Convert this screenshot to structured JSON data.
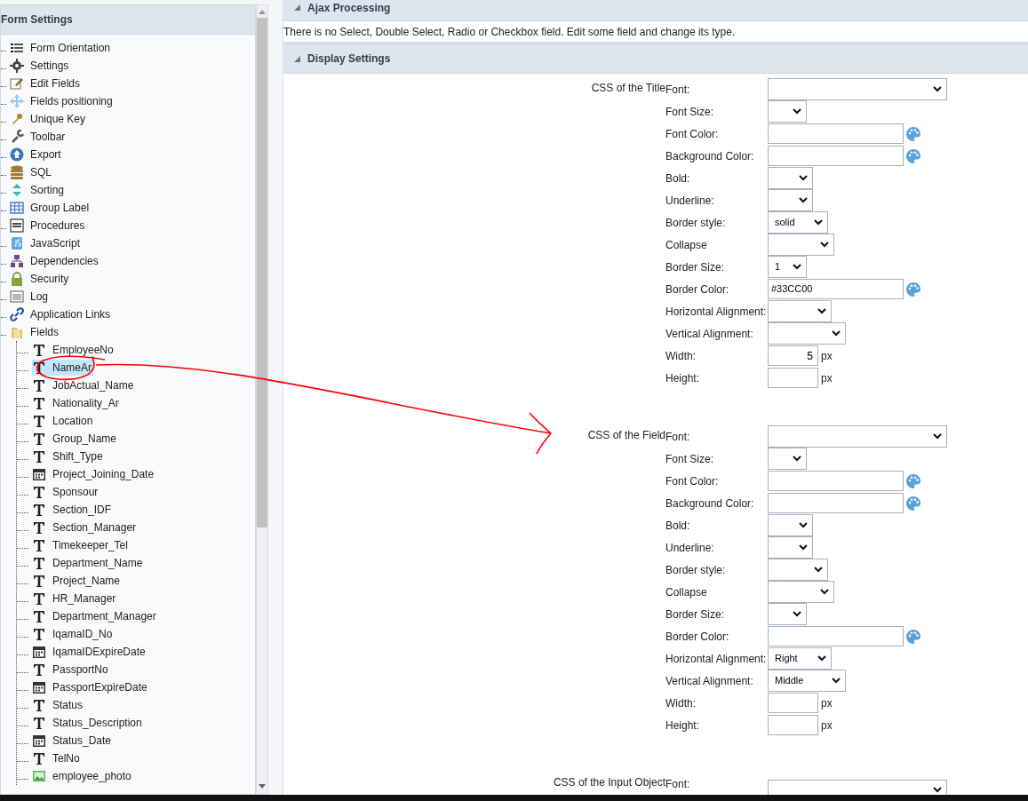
{
  "sidebar": {
    "title": "Form Settings",
    "items": [
      {
        "label": "Form Orientation"
      },
      {
        "label": "Settings"
      },
      {
        "label": "Edit Fields"
      },
      {
        "label": "Fields positioning"
      },
      {
        "label": "Unique Key"
      },
      {
        "label": "Toolbar"
      },
      {
        "label": "Export"
      },
      {
        "label": "SQL"
      },
      {
        "label": "Sorting"
      },
      {
        "label": "Group Label"
      },
      {
        "label": "Procedures"
      },
      {
        "label": "JavaScript"
      },
      {
        "label": "Dependencies"
      },
      {
        "label": "Security"
      },
      {
        "label": "Log"
      },
      {
        "label": "Application Links"
      },
      {
        "label": "Fields",
        "expanded": true,
        "children": [
          {
            "label": "EmployeeNo",
            "kind": "text",
            "selected": false
          },
          {
            "label": "NameAr",
            "kind": "text",
            "selected": true
          },
          {
            "label": "JobActual_Name",
            "kind": "text",
            "selected": false
          },
          {
            "label": "Nationality_Ar",
            "kind": "text",
            "selected": false
          },
          {
            "label": "Location",
            "kind": "text",
            "selected": false
          },
          {
            "label": "Group_Name",
            "kind": "text",
            "selected": false
          },
          {
            "label": "Shift_Type",
            "kind": "text",
            "selected": false
          },
          {
            "label": "Project_Joining_Date",
            "kind": "date",
            "selected": false
          },
          {
            "label": "Sponsour",
            "kind": "text",
            "selected": false
          },
          {
            "label": "Section_IDF",
            "kind": "text",
            "selected": false
          },
          {
            "label": "Section_Manager",
            "kind": "text",
            "selected": false
          },
          {
            "label": "Timekeeper_Tel",
            "kind": "text",
            "selected": false
          },
          {
            "label": "Department_Name",
            "kind": "text",
            "selected": false
          },
          {
            "label": "Project_Name",
            "kind": "text",
            "selected": false
          },
          {
            "label": "HR_Manager",
            "kind": "text",
            "selected": false
          },
          {
            "label": "Department_Manager",
            "kind": "text",
            "selected": false
          },
          {
            "label": "IqamaID_No",
            "kind": "text",
            "selected": false
          },
          {
            "label": "IqamaIDExpireDate",
            "kind": "date",
            "selected": false
          },
          {
            "label": "PassportNo",
            "kind": "text",
            "selected": false
          },
          {
            "label": "PassportExpireDate",
            "kind": "date",
            "selected": false
          },
          {
            "label": "Status",
            "kind": "text",
            "selected": false
          },
          {
            "label": "Status_Description",
            "kind": "text",
            "selected": false
          },
          {
            "label": "Status_Date",
            "kind": "date",
            "selected": false
          },
          {
            "label": "TelNo",
            "kind": "text",
            "selected": false
          },
          {
            "label": "employee_photo",
            "kind": "image",
            "selected": false
          }
        ]
      }
    ]
  },
  "ajax": {
    "title": "Ajax Processing",
    "message": "There is no Select, Double Select, Radio or Checkbox field. Edit some field and change its type."
  },
  "display": {
    "title": "Display Settings",
    "sections": [
      {
        "title": "CSS of the Title",
        "rows": [
          {
            "label": "Font:",
            "kind": "select"
          },
          {
            "label": "Font Size:",
            "kind": "select"
          },
          {
            "label": "Font Color:",
            "kind": "color"
          },
          {
            "label": "Background Color:",
            "kind": "color"
          },
          {
            "label": "Bold:",
            "kind": "select"
          },
          {
            "label": "Underline:",
            "kind": "select"
          },
          {
            "label": "Border style:",
            "kind": "select",
            "value": "solid"
          },
          {
            "label": "Collapse",
            "kind": "select"
          },
          {
            "label": "Border Size:",
            "kind": "select",
            "value": "1"
          },
          {
            "label": "Border Color:",
            "kind": "color",
            "value": "#33CC00"
          },
          {
            "label": "Horizontal Alignment:",
            "kind": "select"
          },
          {
            "label": "Vertical Alignment:",
            "kind": "select"
          },
          {
            "label": "Width:",
            "kind": "size",
            "value": "5",
            "unit": "px"
          },
          {
            "label": "Height:",
            "kind": "size",
            "unit": "px"
          }
        ]
      },
      {
        "title": "CSS of the Field",
        "rows": [
          {
            "label": "Font:",
            "kind": "select"
          },
          {
            "label": "Font Size:",
            "kind": "select"
          },
          {
            "label": "Font Color:",
            "kind": "color"
          },
          {
            "label": "Background Color:",
            "kind": "color"
          },
          {
            "label": "Bold:",
            "kind": "select"
          },
          {
            "label": "Underline:",
            "kind": "select"
          },
          {
            "label": "Border style:",
            "kind": "select"
          },
          {
            "label": "Collapse",
            "kind": "select"
          },
          {
            "label": "Border Size:",
            "kind": "select"
          },
          {
            "label": "Border Color:",
            "kind": "color"
          },
          {
            "label": "Horizontal Alignment:",
            "kind": "select",
            "value": "Right"
          },
          {
            "label": "Vertical Alignment:",
            "kind": "select",
            "value": "Middle"
          },
          {
            "label": "Width:",
            "kind": "size",
            "unit": "px"
          },
          {
            "label": "Height:",
            "kind": "size",
            "unit": "px"
          }
        ]
      },
      {
        "title": "CSS of the Input Object",
        "rows": [
          {
            "label": "Font:",
            "kind": "select"
          }
        ]
      }
    ]
  }
}
